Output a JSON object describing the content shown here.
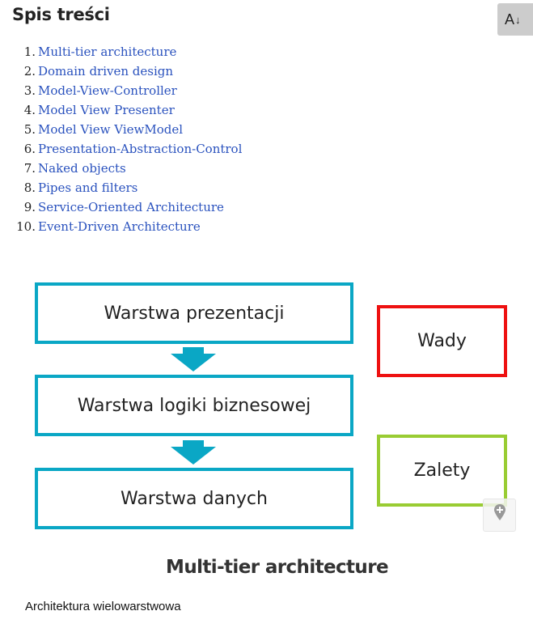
{
  "toc": {
    "title": "Spis treści",
    "font_button_label": "A",
    "font_button_icon": "arrow-down",
    "items": [
      {
        "number": "1.",
        "label": "Multi-tier architecture"
      },
      {
        "number": "2.",
        "label": "Domain driven design"
      },
      {
        "number": "3.",
        "label": "Model-View-Controller"
      },
      {
        "number": "4.",
        "label": "Model View Presenter"
      },
      {
        "number": "5.",
        "label": "Model View ViewModel"
      },
      {
        "number": "6.",
        "label": "Presentation-Abstraction-Control"
      },
      {
        "number": "7.",
        "label": "Naked objects"
      },
      {
        "number": "8.",
        "label": "Pipes and filters"
      },
      {
        "number": "9.",
        "label": "Service-Oriented Architecture"
      },
      {
        "number": "10.",
        "label": "Event-Driven Architecture"
      }
    ]
  },
  "diagram": {
    "layers": [
      "Warstwa prezentacji",
      "Warstwa logiki biznesowej",
      "Warstwa danych"
    ],
    "drawbacks_label": "Wady",
    "advantages_label": "Zalety",
    "colors": {
      "layer_border": "#0aa7c5",
      "drawbacks_border": "#ee1111",
      "advantages_border": "#99cc33"
    },
    "pin_button_icon": "map-pin-plus"
  },
  "section": {
    "title": "Multi-tier architecture",
    "text": "Architektura wielowarstwowa"
  }
}
